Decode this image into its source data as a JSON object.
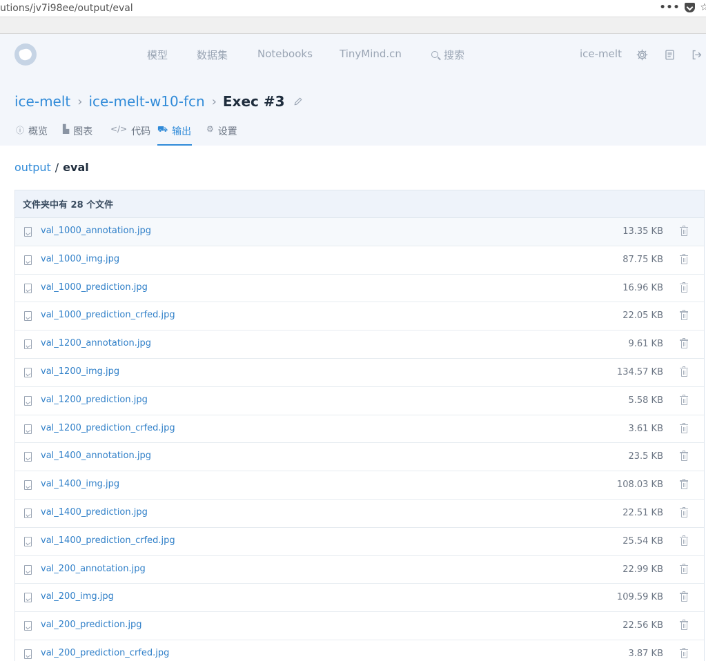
{
  "browser": {
    "url": "utions/jv7i98ee/output/eval",
    "menu_dots": "•••",
    "pocket_icon": "pocket-icon",
    "star_icon": "☆"
  },
  "header": {
    "nav": {
      "models": "模型",
      "datasets": "数据集",
      "notebooks": "Notebooks",
      "tinymind": "TinyMind.cn",
      "search": "搜索"
    },
    "user": "ice-melt"
  },
  "breadcrumb": {
    "user": "ice-melt",
    "project": "ice-melt-w10-fcn",
    "current": "Exec #3"
  },
  "tabs": {
    "overview": "概览",
    "charts": "图表",
    "code": "代码",
    "output": "输出",
    "settings": "设置",
    "active": "output"
  },
  "path": {
    "root": "output",
    "separator": "/",
    "current": "eval"
  },
  "files": {
    "summary": "文件夹中有 28 个文件",
    "rows": [
      {
        "name": "val_1000_annotation.jpg",
        "size": "13.35 KB"
      },
      {
        "name": "val_1000_img.jpg",
        "size": "87.75 KB"
      },
      {
        "name": "val_1000_prediction.jpg",
        "size": "16.96 KB"
      },
      {
        "name": "val_1000_prediction_crfed.jpg",
        "size": "22.05 KB"
      },
      {
        "name": "val_1200_annotation.jpg",
        "size": "9.61 KB"
      },
      {
        "name": "val_1200_img.jpg",
        "size": "134.57 KB"
      },
      {
        "name": "val_1200_prediction.jpg",
        "size": "5.58 KB"
      },
      {
        "name": "val_1200_prediction_crfed.jpg",
        "size": "3.61 KB"
      },
      {
        "name": "val_1400_annotation.jpg",
        "size": "23.5 KB"
      },
      {
        "name": "val_1400_img.jpg",
        "size": "108.03 KB"
      },
      {
        "name": "val_1400_prediction.jpg",
        "size": "22.51 KB"
      },
      {
        "name": "val_1400_prediction_crfed.jpg",
        "size": "25.54 KB"
      },
      {
        "name": "val_200_annotation.jpg",
        "size": "22.99 KB"
      },
      {
        "name": "val_200_img.jpg",
        "size": "109.59 KB"
      },
      {
        "name": "val_200_prediction.jpg",
        "size": "22.56 KB"
      },
      {
        "name": "val_200_prediction_crfed.jpg",
        "size": "3.87 KB"
      }
    ]
  },
  "colors": {
    "link": "#2f8ad8",
    "header_bg": "#f3f6fb",
    "table_header_bg": "#eef3fa"
  }
}
